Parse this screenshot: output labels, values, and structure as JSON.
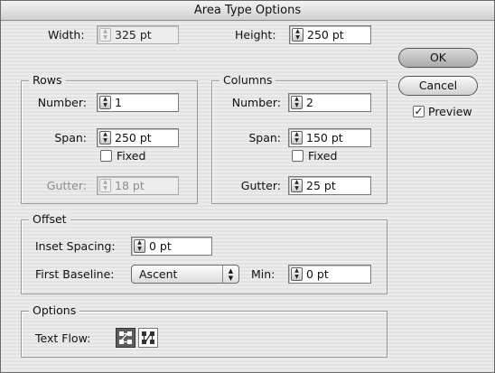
{
  "title": "Area Type Options",
  "width": {
    "label": "Width:",
    "value": "325 pt"
  },
  "height": {
    "label": "Height:",
    "value": "250 pt"
  },
  "rows": {
    "legend": "Rows",
    "number_label": "Number:",
    "number_value": "1",
    "span_label": "Span:",
    "span_value": "250 pt",
    "fixed_label": "Fixed",
    "gutter_label": "Gutter:",
    "gutter_value": "18 pt"
  },
  "columns": {
    "legend": "Columns",
    "number_label": "Number:",
    "number_value": "2",
    "span_label": "Span:",
    "span_value": "150 pt",
    "fixed_label": "Fixed",
    "gutter_label": "Gutter:",
    "gutter_value": "25 pt"
  },
  "offset": {
    "legend": "Offset",
    "inset_label": "Inset Spacing:",
    "inset_value": "0 pt",
    "baseline_label": "First Baseline:",
    "baseline_value": "Ascent",
    "min_label": "Min:",
    "min_value": "0 pt"
  },
  "options": {
    "legend": "Options",
    "textflow_label": "Text Flow:"
  },
  "buttons": {
    "ok": "OK",
    "cancel": "Cancel"
  },
  "preview": {
    "label": "Preview",
    "checked": true
  }
}
